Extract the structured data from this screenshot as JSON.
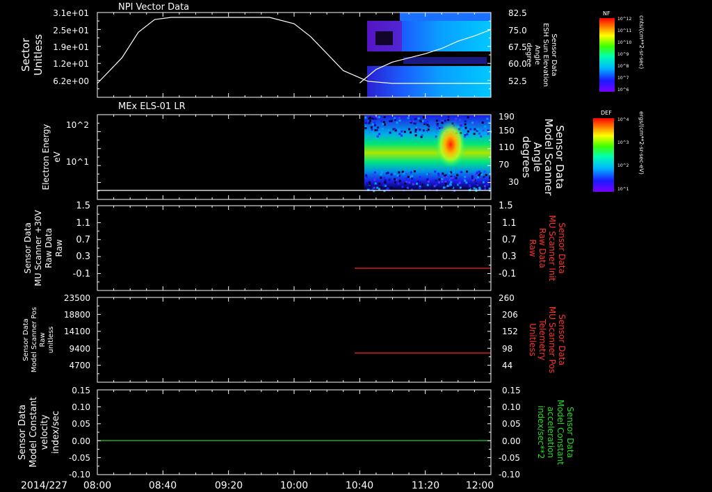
{
  "colors": {
    "background": "#000000",
    "axis": "#ffffff",
    "red_trace": "#ff2020",
    "green_trace": "#22cc22",
    "red_label": "#ff3030",
    "green_label": "#22dd22"
  },
  "colorbars": {
    "nf": {
      "title": "NF",
      "unit": "cnts/(cm**2-sr-sec)",
      "ticks": [
        "10^12",
        "10^11",
        "10^10",
        "10^9",
        "10^8",
        "10^7",
        "10^6"
      ]
    },
    "def": {
      "title": "DEF",
      "unit": "ergs/(cm**2-sr-sec-eV)",
      "ticks": [
        "10^4",
        "10^3",
        "10^2",
        "10^1"
      ]
    }
  },
  "time_axis": {
    "date": "2014/227",
    "ticks": [
      "08:00",
      "08:40",
      "09:20",
      "10:00",
      "10:40",
      "11:20",
      "12:00"
    ]
  },
  "chart_data": [
    {
      "type": "line",
      "title": "NPI Vector Data",
      "left_ylabel": [
        "Sector",
        "Unitless"
      ],
      "left_ticks": [
        "3.1e+01",
        "2.5e+01",
        "1.9e+01",
        "1.2e+01",
        "6.2e+00"
      ],
      "right_ylabel": [
        "Sensor Data",
        "ESH Sun Elevation",
        "Angle",
        "degree"
      ],
      "right_ticks": [
        "82.5",
        "75.0",
        "67.5",
        "60.0",
        "52.5"
      ],
      "sector_trace": {
        "x_min": [
          480,
          495,
          505,
          515,
          525,
          545,
          585,
          600,
          610,
          620,
          630,
          645,
          660,
          680,
          720
        ],
        "y": [
          0,
          12,
          24,
          30,
          31,
          31,
          31,
          28,
          22,
          14,
          6,
          1,
          0,
          0,
          0
        ]
      },
      "sun_elevation_trace": {
        "x_min": [
          640,
          650,
          660,
          670,
          680,
          690,
          700,
          710,
          720
        ],
        "y": [
          50.5,
          57,
          60.5,
          62.5,
          64.5,
          67,
          70.5,
          73,
          76
        ]
      },
      "spectrogram_start": "10:40"
    },
    {
      "type": "heatmap",
      "title": "MEx ELS-01 LR",
      "left_ylabel": [
        "Electron Energy",
        "eV"
      ],
      "left_ticks": [
        "10^2",
        "10^1"
      ],
      "right_ylabel": [
        "Sensor Data",
        "Model Scanner",
        "Angle",
        "degrees"
      ],
      "right_ticks": [
        "190",
        "150",
        "110",
        "70",
        "30"
      ],
      "heatmap_start": "10:40",
      "peak_time": "11:30",
      "baseline_value": "1"
    },
    {
      "type": "line",
      "left_ylabel": [
        "Sensor Data",
        "MU Scanner +30V",
        "Raw Data",
        "Raw"
      ],
      "left_ticks": [
        "1.5",
        "1.1",
        "0.7",
        "0.3",
        "-0.1"
      ],
      "right_ylabel": [
        "Sensor Data",
        "MU Scanner Init",
        "Raw Data",
        "Raw"
      ],
      "right_ticks": [
        "1.5",
        "1.1",
        "0.7",
        "0.3",
        "-0.1"
      ],
      "series": [
        {
          "x_range": [
            "10:35",
            "12:00"
          ],
          "y": -0.05
        }
      ]
    },
    {
      "type": "line",
      "left_ylabel": [
        "Sensor Data",
        "Model Scanner Pos",
        "Raw",
        "unitless"
      ],
      "left_ticks": [
        "23500",
        "18800",
        "14100",
        "9400",
        "4700"
      ],
      "right_ylabel": [
        "Sensor Data",
        "MU Scanner Pos",
        "Telemetry",
        "Unitless"
      ],
      "right_ticks": [
        "260",
        "206",
        "152",
        "98",
        "44"
      ],
      "series": [
        {
          "x_range": [
            "10:35",
            "12:00"
          ],
          "y": 8200
        }
      ]
    },
    {
      "type": "line",
      "left_ylabel": [
        "Sensor Data",
        "Model Constant",
        "velocity",
        "index/sec"
      ],
      "left_ticks": [
        "0.15",
        "0.10",
        "0.05",
        "0.00",
        "-0.05",
        "-0.10"
      ],
      "right_ylabel": [
        "Sensor Data",
        "Model Constant",
        "acceleration",
        "index/sec**2"
      ],
      "right_ticks": [
        "0.15",
        "0.10",
        "0.05",
        "0.00",
        "-0.05",
        "-0.10"
      ],
      "series": [
        {
          "x_range": [
            "08:00",
            "12:00"
          ],
          "y": 0.0
        }
      ]
    }
  ]
}
